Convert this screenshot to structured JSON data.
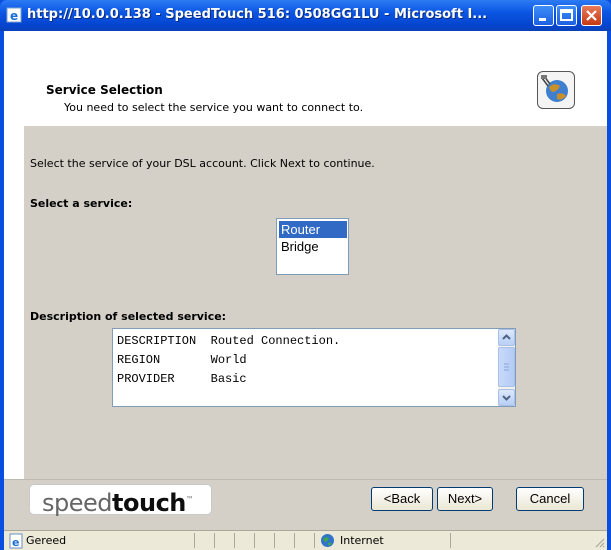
{
  "window": {
    "title": "http://10.0.0.138 - SpeedTouch 516:  0508GG1LU - Microsoft I...",
    "buttons": [
      "minimize-icon",
      "maximize-icon",
      "close-icon"
    ]
  },
  "header": {
    "title": "Service Selection",
    "subtitle": "You need to select the service you want to connect to."
  },
  "panel": {
    "intro": "Select the service of your DSL account. Click Next to continue.",
    "service_label": "Select a service:",
    "services": [
      {
        "label": "Router",
        "selected": true
      },
      {
        "label": "Bridge",
        "selected": false
      }
    ],
    "description_label": "Description of selected service:",
    "description_rows": [
      "DESCRIPTION  Routed Connection.",
      "REGION       World",
      "PROVIDER     Basic"
    ]
  },
  "footer": {
    "logo_light": "speed",
    "logo_bold": "touch",
    "logo_tm": "™",
    "back_label": "<Back",
    "next_label": "Next>",
    "cancel_label": "Cancel"
  },
  "statusbar": {
    "status": "Gereed",
    "zone": "Internet"
  },
  "colors": {
    "titlebar": "#0b56e3",
    "panel": "#d4d0c8",
    "selection": "#316ac5"
  }
}
